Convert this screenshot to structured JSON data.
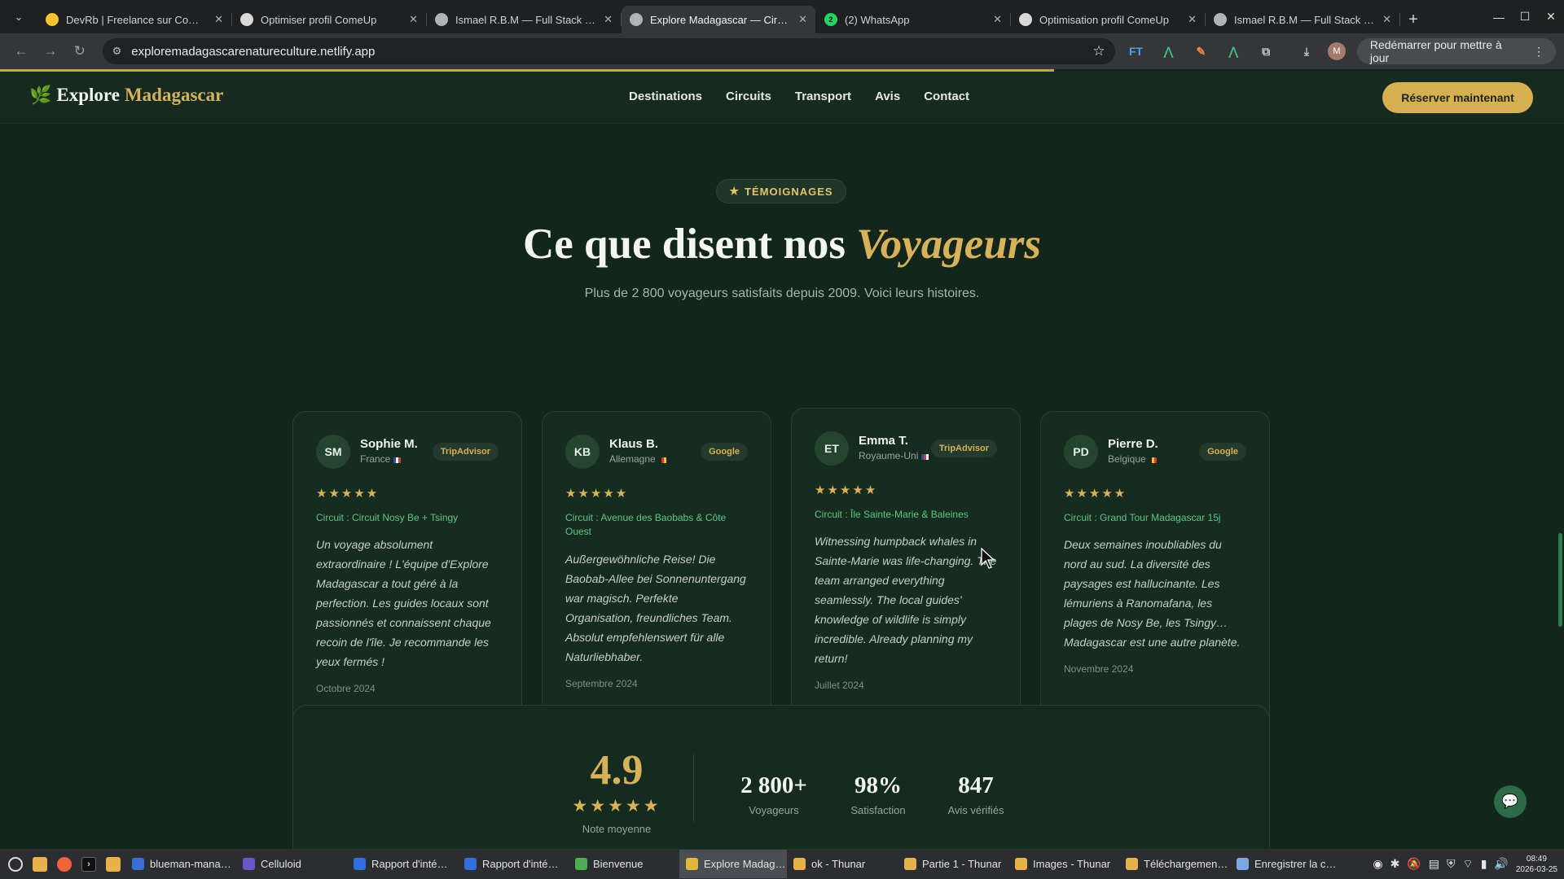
{
  "browser": {
    "tabs": [
      {
        "title": "DevRb | Freelance sur ComeUp",
        "favicon_color": "#f4c430",
        "favicon_text": "",
        "active": false
      },
      {
        "title": "Optimiser profil ComeUp",
        "favicon_color": "#d9d9d9",
        "favicon_text": "",
        "active": false
      },
      {
        "title": "Ismael R.B.M — Full Stack Developer",
        "favicon_color": "#b0b3b8",
        "favicon_text": "",
        "active": false
      },
      {
        "title": "Explore Madagascar — Circuits",
        "favicon_color": "#b0b3b8",
        "favicon_text": "",
        "active": true
      },
      {
        "title": "(2) WhatsApp",
        "favicon_color": "#25d366",
        "favicon_text": "2",
        "active": false
      },
      {
        "title": "Optimisation profil ComeUp",
        "favicon_color": "#d9d9d9",
        "favicon_text": "",
        "active": false
      },
      {
        "title": "Ismael R.B.M — Full Stack Developer",
        "favicon_color": "#b0b3b8",
        "favicon_text": "",
        "active": false
      }
    ],
    "url": "exploremadagascarenatureculture.netlify.app",
    "profile_initial": "M",
    "update_label": "Redémarrer pour mettre à jour"
  },
  "site": {
    "logo_first": "Explore",
    "logo_second": "Madagascar",
    "nav": {
      "destinations": "Destinations",
      "circuits": "Circuits",
      "transport": "Transport",
      "avis": "Avis",
      "contact": "Contact"
    },
    "cta": "Réserver maintenant",
    "badge": "TÉMOIGNAGES",
    "heading_plain": "Ce que disent nos",
    "heading_accent": "Voyageurs",
    "subtitle": "Plus de 2 800 voyageurs satisfaits depuis 2009. Voici leurs histoires.",
    "reviews": [
      {
        "initials": "SM",
        "name": "Sophie M.",
        "country": "France",
        "source": "TripAdvisor",
        "stars": "★★★★★",
        "circuit": "Circuit : Circuit Nosy Be + Tsingy",
        "quote": "Un voyage absolument extraordinaire ! L'équipe d'Explore Madagascar a tout géré à la perfection. Les guides locaux sont passionnés et connaissent chaque recoin de l'île. Je recommande les yeux fermés !",
        "date": "Octobre 2024"
      },
      {
        "initials": "KB",
        "name": "Klaus B.",
        "country": "Allemagne",
        "source": "Google",
        "stars": "★★★★★",
        "circuit": "Circuit : Avenue des Baobabs & Côte Ouest",
        "quote": "Außergewöhnliche Reise! Die Baobab-Allee bei Sonnenuntergang war magisch. Perfekte Organisation, freundliches Team. Absolut empfehlenswert für alle Naturliebhaber.",
        "date": "Septembre 2024"
      },
      {
        "initials": "ET",
        "name": "Emma T.",
        "country": "Royaume-Uni",
        "source": "TripAdvisor",
        "stars": "★★★★★",
        "circuit": "Circuit : Île Sainte-Marie & Baleines",
        "quote": "Witnessing humpback whales in Sainte-Marie was life-changing. The team arranged everything seamlessly. The local guides' knowledge of wildlife is simply incredible. Already planning my return!",
        "date": "Juillet 2024"
      },
      {
        "initials": "PD",
        "name": "Pierre D.",
        "country": "Belgique",
        "source": "Google",
        "stars": "★★★★★",
        "circuit": "Circuit : Grand Tour Madagascar 15j",
        "quote": "Deux semaines inoubliables du nord au sud. La diversité des paysages est hallucinante. Les lémuriens à Ranomafana, les plages de Nosy Be, les Tsingy… Madagascar est une autre planète.",
        "date": "Novembre 2024"
      }
    ],
    "stats": {
      "rating": "4.9",
      "rating_stars": "★★★★★",
      "rating_label": "Note moyenne",
      "items": [
        {
          "value": "2 800+",
          "label": "Voyageurs"
        },
        {
          "value": "98%",
          "label": "Satisfaction"
        },
        {
          "value": "847",
          "label": "Avis vérifiés"
        }
      ]
    }
  },
  "taskbar": {
    "tasks": [
      {
        "label": "blueman-mana…",
        "color": "#3b6fd8",
        "active": false
      },
      {
        "label": "Celluloid",
        "color": "#6b55c9",
        "active": false
      },
      {
        "label": "Rapport d'inté…",
        "color": "#2f6fe0",
        "active": false
      },
      {
        "label": "Rapport d'inté…",
        "color": "#2f6fe0",
        "active": false
      },
      {
        "label": "Bienvenue",
        "color": "#4caf50",
        "active": false
      },
      {
        "label": "Explore Madag…",
        "color": "#e0b73a",
        "active": true
      },
      {
        "label": "ok - Thunar",
        "color": "#e8b24a",
        "active": false
      },
      {
        "label": "Partie 1 - Thunar",
        "color": "#e8b24a",
        "active": false
      },
      {
        "label": "Images - Thunar",
        "color": "#e8b24a",
        "active": false
      },
      {
        "label": "Téléchargemen…",
        "color": "#e8b24a",
        "active": false
      },
      {
        "label": "Enregistrer la c…",
        "color": "#7aa8e0",
        "active": false
      }
    ],
    "time": "08:49",
    "date": "2026-03-25"
  },
  "colors": {
    "accent_gold": "#d8b25a",
    "accent_green": "#5ec58a",
    "background": "#13261c"
  }
}
